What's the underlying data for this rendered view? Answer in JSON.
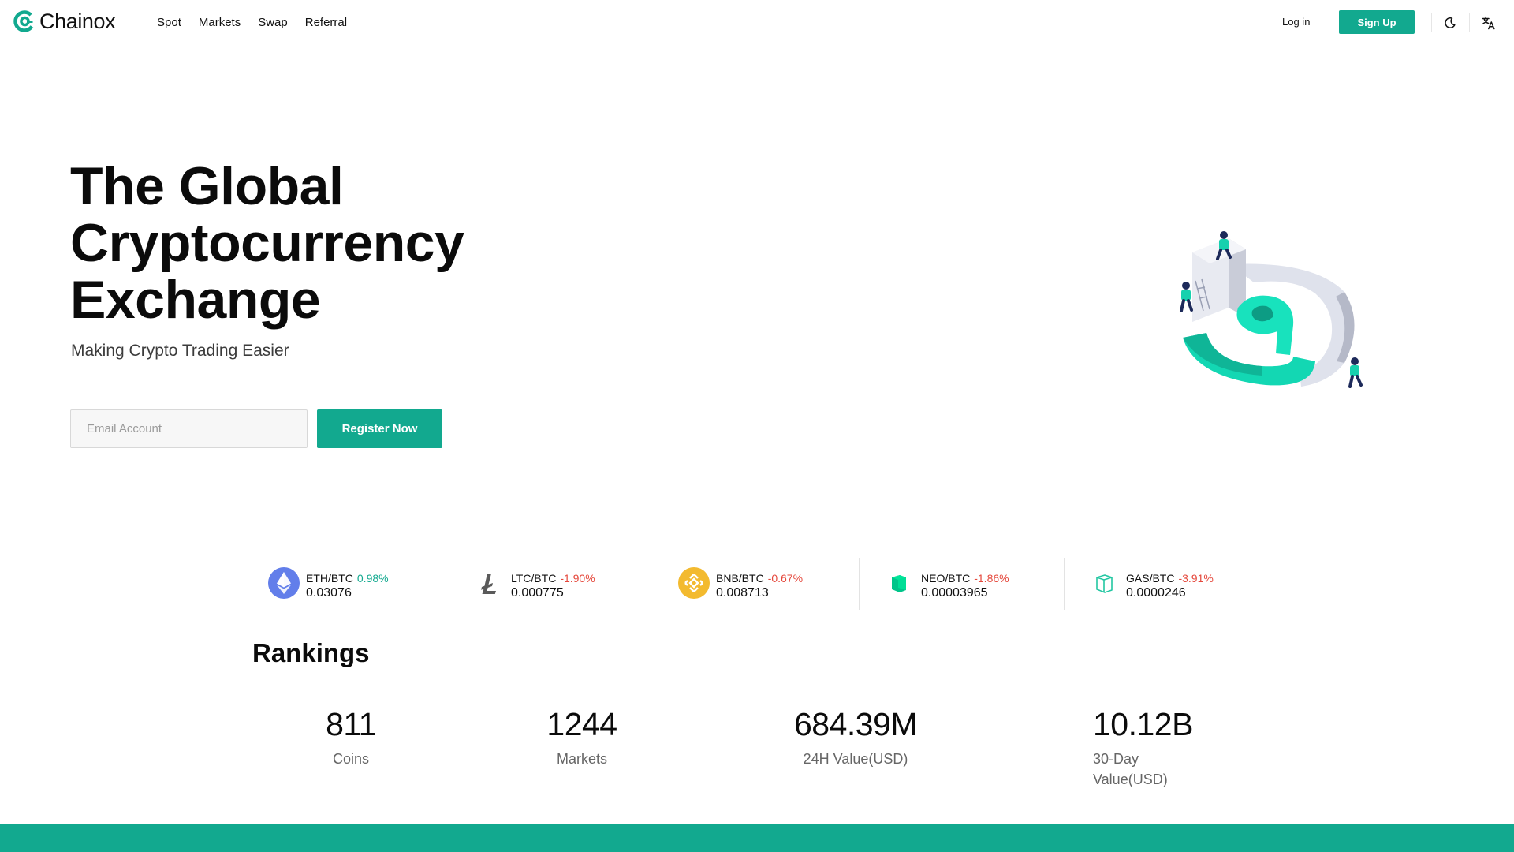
{
  "brand": {
    "name": "Chainox",
    "accent": "#12a98f"
  },
  "nav": {
    "items": [
      "Spot",
      "Markets",
      "Swap",
      "Referral"
    ]
  },
  "header": {
    "login_label": "Log in",
    "signup_label": "Sign Up",
    "theme_icon": "moon-icon",
    "language_icon": "translate-icon"
  },
  "hero": {
    "title_lines": [
      "The Global",
      "Cryptocurrency",
      "Exchange"
    ],
    "subtitle": "Making Crypto Trading Easier",
    "email_placeholder": "Email Account",
    "register_label": "Register Now"
  },
  "ticker": [
    {
      "pair": "ETH/BTC",
      "change": "0.98%",
      "direction": "up",
      "price": "0.03076",
      "icon": "ethereum-icon"
    },
    {
      "pair": "LTC/BTC",
      "change": "-1.90%",
      "direction": "down",
      "price": "0.000775",
      "icon": "litecoin-icon"
    },
    {
      "pair": "BNB/BTC",
      "change": "-0.67%",
      "direction": "down",
      "price": "0.008713",
      "icon": "bnb-icon"
    },
    {
      "pair": "NEO/BTC",
      "change": "-1.86%",
      "direction": "down",
      "price": "0.00003965",
      "icon": "neo-icon"
    },
    {
      "pair": "GAS/BTC",
      "change": "-3.91%",
      "direction": "down",
      "price": "0.0000246",
      "icon": "gas-icon"
    }
  ],
  "rankings": {
    "title": "Rankings",
    "stats": [
      {
        "value": "811",
        "label": "Coins"
      },
      {
        "value": "1244",
        "label": "Markets"
      },
      {
        "value": "684.39M",
        "label": "24H Value(USD)"
      },
      {
        "value": "10.12B",
        "label": "30-Day Value(USD)"
      }
    ]
  },
  "colors": {
    "up": "#12a98f",
    "down": "#e5483c",
    "eth": "#627eea",
    "bnb": "#f3ba2f",
    "neo": "#00e599"
  }
}
